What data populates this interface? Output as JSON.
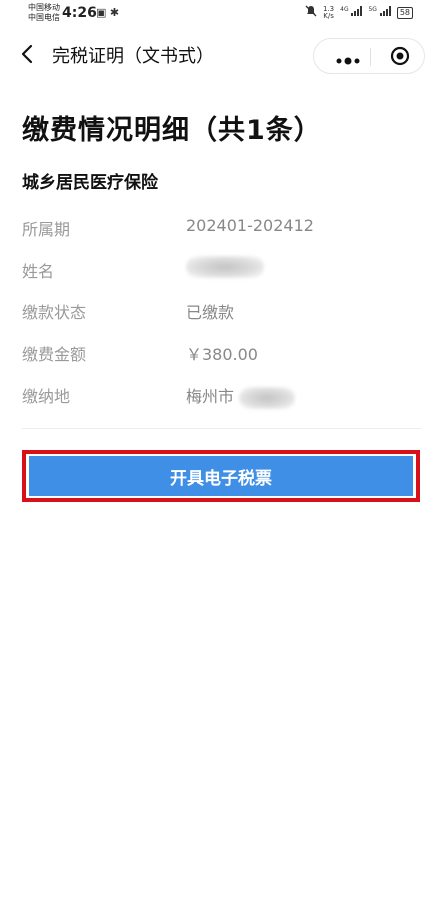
{
  "status_bar": {
    "carrier_1": "中国移动",
    "carrier_2": "中国电信",
    "time": "4:26",
    "net_speed": "1.3",
    "net_speed_unit": "K/s",
    "network_1": "4G",
    "network_2": "5G",
    "battery": "58"
  },
  "nav": {
    "title": "完税证明（文书式）"
  },
  "page": {
    "heading": "缴费情况明细（共1条）",
    "section_title": "城乡居民医疗保险",
    "rows": [
      {
        "label": "所属期",
        "value": "202401-202412"
      },
      {
        "label": "姓名",
        "value": ""
      },
      {
        "label": "缴款状态",
        "value": "已缴款"
      },
      {
        "label": "缴费金额",
        "value": "￥380.00"
      },
      {
        "label": "缴纳地",
        "value": "梅州市"
      }
    ],
    "action_button": "开具电子税票"
  },
  "colors": {
    "button_bg": "#3f8fe6",
    "highlight_border": "#d8101a"
  }
}
